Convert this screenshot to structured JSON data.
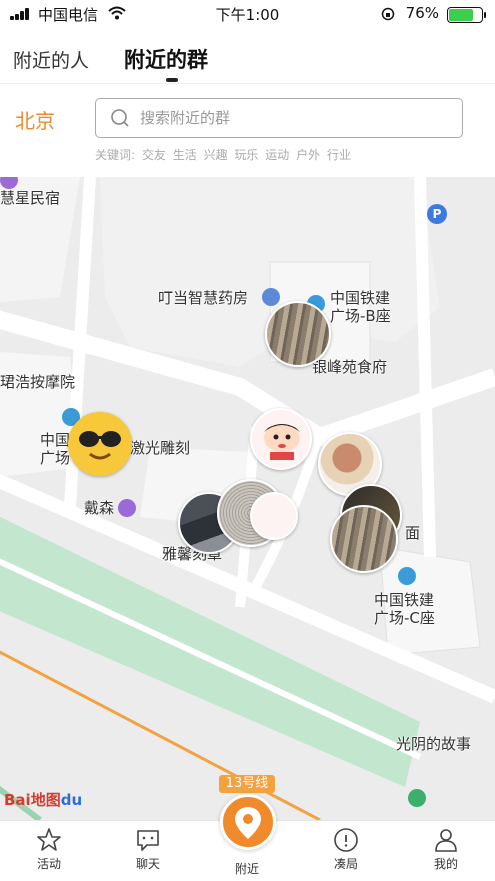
{
  "status_bar": {
    "carrier": "中国电信",
    "time": "下午1:00",
    "battery": "76%"
  },
  "tabs": {
    "people": "附近的人",
    "groups": "附近的群"
  },
  "search": {
    "city": "北京",
    "placeholder": "搜索附近的群",
    "keywords_label": "关键词:",
    "keywords": [
      "交友",
      "生活",
      "兴趣",
      "玩乐",
      "运动",
      "户外",
      "行业"
    ]
  },
  "map": {
    "pois": {
      "huixing": "慧星民宿",
      "dingdang": "叮当智慧药房",
      "tiejian_b": "中国铁建\n广场-B座",
      "yinfeng": "银峰苑食府",
      "jiehao": "珺浩按摩院",
      "tiejian_a": "中国\n广场",
      "jiguang": "激光雕刻",
      "daisen": "戴森",
      "yaxin": "雅馨刻章",
      "mian": "面",
      "tiejian_c": "中国铁建\n广场-C座",
      "guangyin": "光阴的故事",
      "line13": "13号线",
      "baidu": "Bai地图",
      "baidu_du": "du"
    },
    "colors": {
      "road": "#ffffff",
      "block": "#f6f6f6",
      "green": "#bfe4cc",
      "rail": "#f2a241",
      "accent": "#f08a2a"
    }
  },
  "bottom_nav": {
    "activity": "活动",
    "chat": "聊天",
    "nearby": "附近",
    "meetup": "凑局",
    "mine": "我的"
  }
}
